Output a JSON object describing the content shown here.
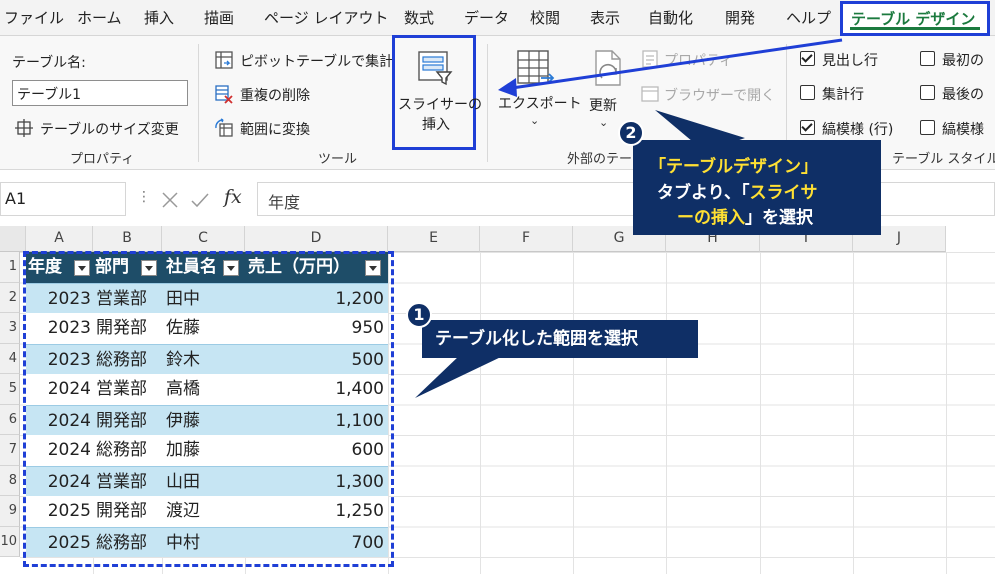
{
  "menu": {
    "items": [
      "ファイル",
      "ホーム",
      "挿入",
      "描画",
      "ページ レイアウト",
      "数式",
      "データ",
      "校閲",
      "表示",
      "自動化",
      "開発",
      "ヘルプ"
    ],
    "active_tab": "テーブル デザイン"
  },
  "ribbon": {
    "properties": {
      "table_name_label": "テーブル名:",
      "table_name_value": "テーブル1",
      "resize_label": "テーブルのサイズ変更",
      "group_label": "プロパティ"
    },
    "tools": {
      "pivot_label": "ピボットテーブルで集計",
      "remove_dup_label": "重複の削除",
      "convert_label": "範囲に変換",
      "slicer_line1": "スライサーの",
      "slicer_line2": "挿入",
      "group_label": "ツール"
    },
    "external": {
      "export_label": "エクスポート",
      "refresh_label": "更新",
      "properties_label": "プロパティ",
      "browser_label": "ブラウザーで開く",
      "group_label": "外部のテー"
    },
    "style_options": {
      "header_row": "見出し行",
      "total_row": "集計行",
      "banded_rows": "縞模様 (行)",
      "first_col": "最初の",
      "last_col": "最後の",
      "banded_cols": "縞模様",
      "group_label": "テーブル スタイル"
    }
  },
  "formula_bar": {
    "name_box": "A1",
    "fx": "fx",
    "content": "年度"
  },
  "columns": [
    "A",
    "B",
    "C",
    "D",
    "E",
    "F",
    "G",
    "H",
    "I",
    "J"
  ],
  "rows": [
    "1",
    "2",
    "3",
    "4",
    "5",
    "6",
    "7",
    "8",
    "9",
    "10"
  ],
  "table": {
    "headers": [
      "年度",
      "部門",
      "社員名",
      "売上（万円）"
    ],
    "rows": [
      [
        "2023",
        "営業部",
        "田中",
        "1,200"
      ],
      [
        "2023",
        "開発部",
        "佐藤",
        "950"
      ],
      [
        "2023",
        "総務部",
        "鈴木",
        "500"
      ],
      [
        "2024",
        "営業部",
        "高橋",
        "1,400"
      ],
      [
        "2024",
        "開発部",
        "伊藤",
        "1,100"
      ],
      [
        "2024",
        "総務部",
        "加藤",
        "600"
      ],
      [
        "2024",
        "営業部",
        "山田",
        "1,300"
      ],
      [
        "2025",
        "開発部",
        "渡辺",
        "1,250"
      ],
      [
        "2025",
        "総務部",
        "中村",
        "700"
      ]
    ]
  },
  "callouts": {
    "step1_number": "1",
    "step1_text": "テーブル化した範囲を選択",
    "step2_number": "2",
    "step2_line1": "「テーブルデザイン」",
    "step2_line2a": "タブより、「",
    "step2_line2b": "スライサ",
    "step2_line3a": "ーの挿入",
    "step2_line3b": "」を選択"
  },
  "colors": {
    "table_header": "#1e4d68",
    "band": "#c6e5f3",
    "callout": "#0f2f66",
    "highlight_border": "#1f3fd6",
    "active_tab_text": "#1b7a3e",
    "callout_highlight": "#ffe033"
  }
}
